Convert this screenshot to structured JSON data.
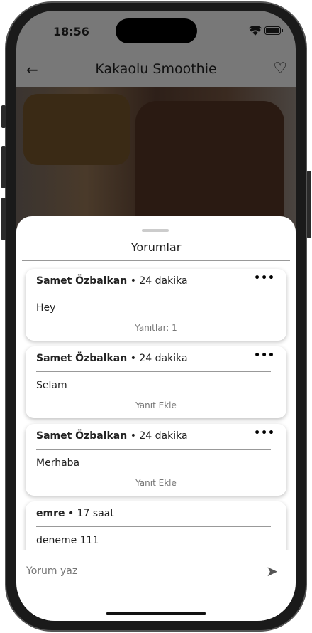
{
  "status": {
    "time": "18:56"
  },
  "appbar": {
    "title": "Kakaolu Smoothie",
    "back_icon": "arrow-left-icon",
    "favorite_icon": "heart-outline-icon"
  },
  "sheet": {
    "title": "Yorumlar"
  },
  "comments": [
    {
      "author": "Samet Özbalkan",
      "time": "• 24 dakika",
      "text": "Hey",
      "footer": "Yanıtlar: 1"
    },
    {
      "author": "Samet Özbalkan",
      "time": "• 24 dakika",
      "text": "Selam",
      "footer": "Yanıt Ekle"
    },
    {
      "author": "Samet Özbalkan",
      "time": "• 24 dakika",
      "text": "Merhaba",
      "footer": "Yanıt Ekle"
    },
    {
      "author": "emre",
      "time": "• 17 saat",
      "text": "deneme 111"
    }
  ],
  "input": {
    "placeholder": "Yorum yaz"
  }
}
